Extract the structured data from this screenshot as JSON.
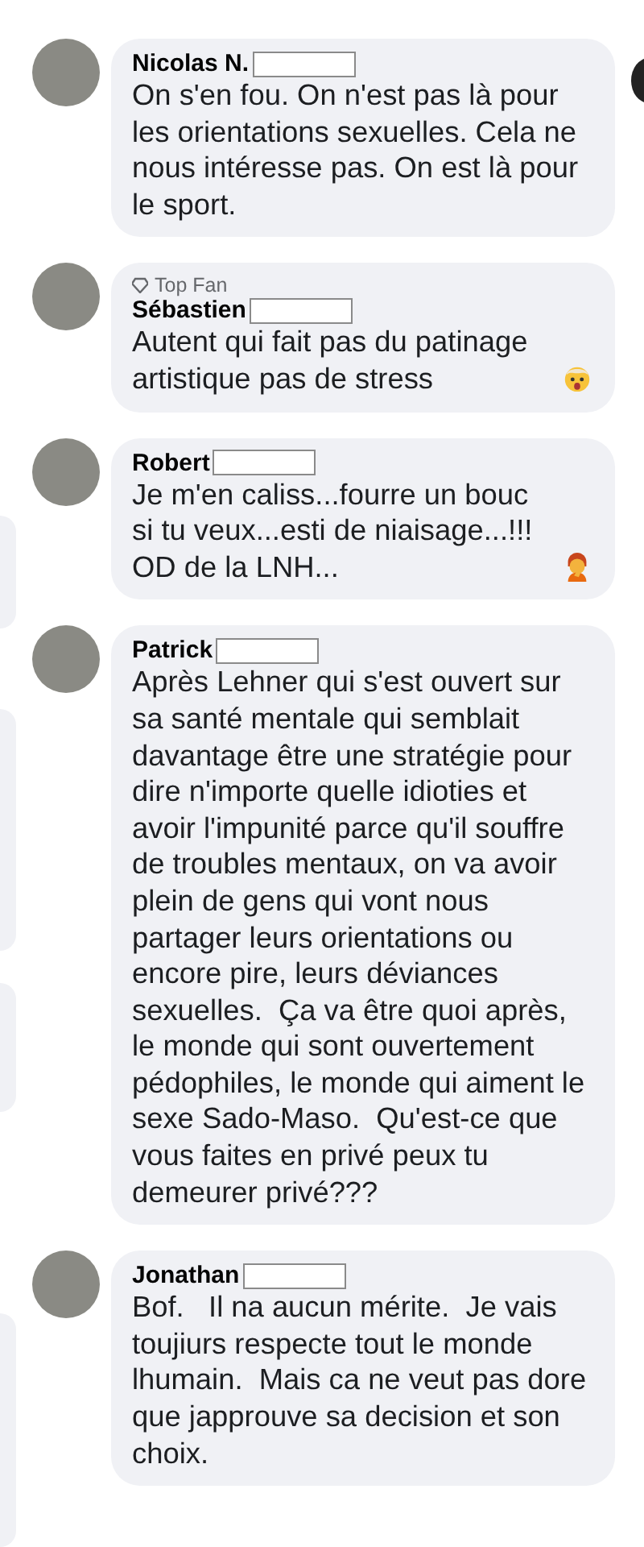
{
  "comments": [
    {
      "author": "Nicolas N.",
      "text": "On s'en fou. On n'est pas là pour les orientations sexuelles. Cela ne nous intéresse pas. On est là pour le sport."
    },
    {
      "author": "Sébastien",
      "badge": "Top Fan",
      "text": "Autent qui fait pas du patinage artistique pas de stress",
      "emoji": {
        "kind": "exploding_head"
      }
    },
    {
      "author": "Robert",
      "text": "Je m'en caliss...fourre un bouc si tu veux...esti de niaisage...!!! OD de la LNH...",
      "emoji": {
        "kind": "facepalm"
      }
    },
    {
      "author": "Patrick",
      "text": "Après Lehner qui s'est ouvert sur sa santé mentale qui semblait davantage être une stratégie pour dire n'importe quelle idioties et avoir l'impunité parce qu'il souffre de troubles mentaux, on va avoir plein de gens qui vont nous partager leurs orientations ou encore pire, leurs déviances sexuelles.  Ça va être quoi après, le monde qui sont ouvertement pédophiles, le monde qui aiment le sexe Sado-Maso.  Qu'est-ce que vous faites en privé peux tu demeurer privé???"
    },
    {
      "author": "Jonathan",
      "text": "Bof.   Il na aucun mérite.  Je vais toujiurs respecte tout le monde lhumain.  Mais ca ne veut pas dore que japprouve sa decision et son choix."
    }
  ]
}
